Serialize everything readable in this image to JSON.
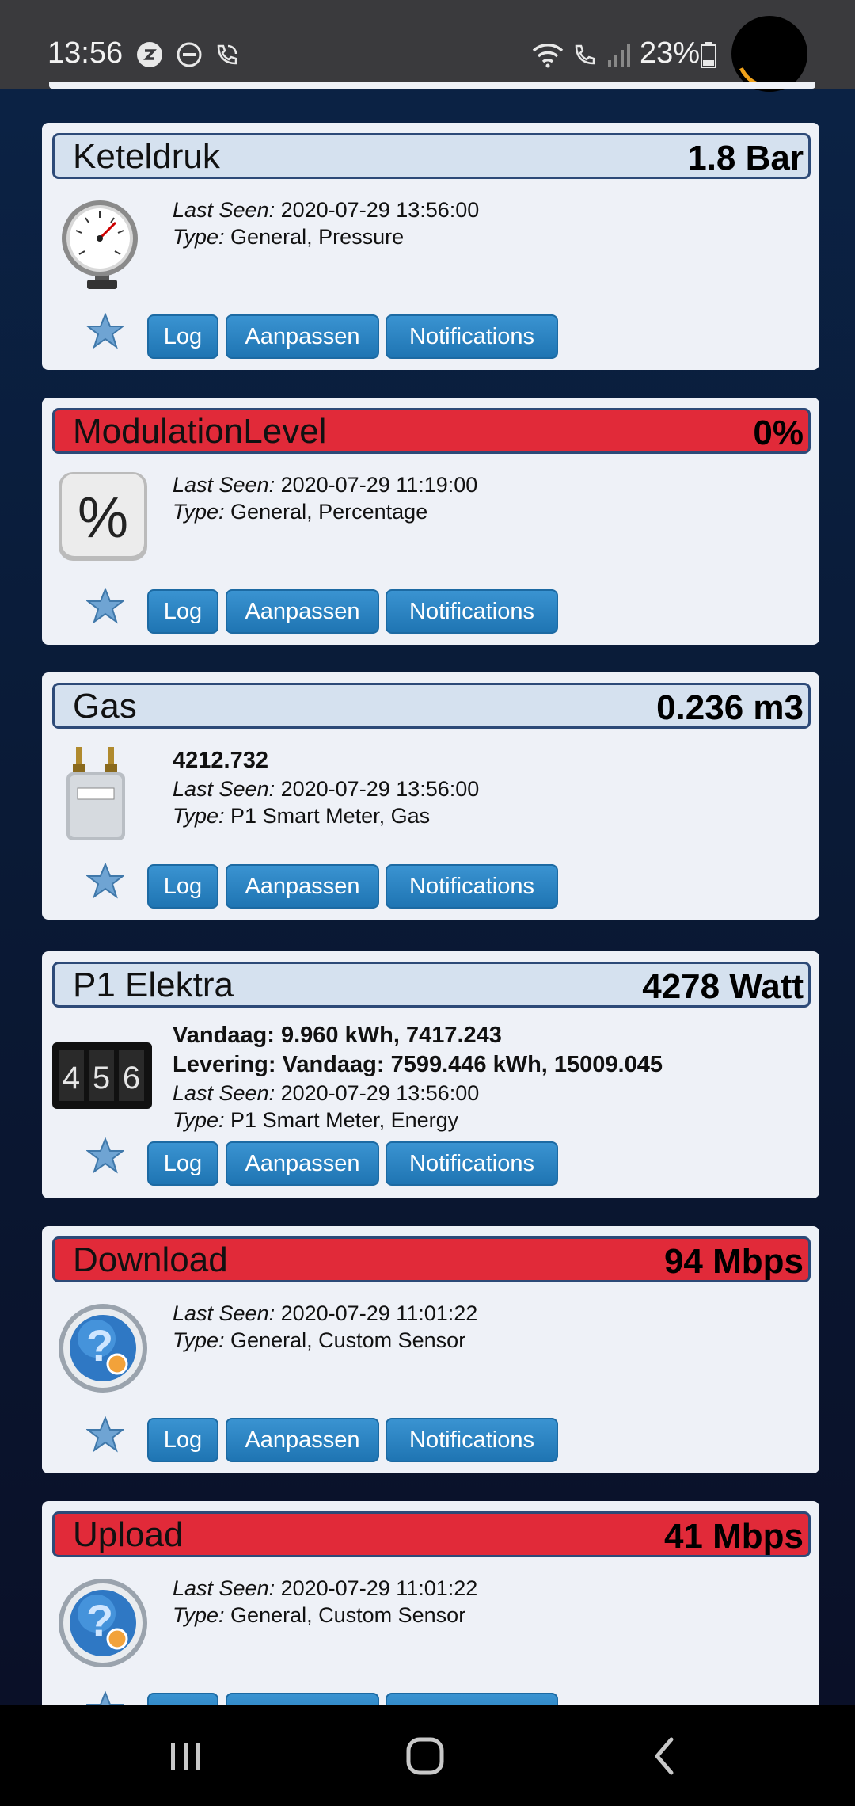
{
  "status_bar": {
    "time": "13:56",
    "battery": "23%",
    "icons": [
      "sync-icon",
      "dnd-icon",
      "wifi-call-icon",
      "wifi-icon",
      "volte-icon",
      "signal-icon",
      "battery-icon"
    ]
  },
  "colors": {
    "header_normal": "#d5e1ef",
    "header_alert": "#e12a39",
    "button": "#2581c2"
  },
  "labels": {
    "last_seen": "Last Seen:",
    "type": "Type:"
  },
  "buttons": {
    "log": "Log",
    "edit": "Aanpassen",
    "notifications": "Notifications"
  },
  "devices": [
    {
      "title": "Keteldruk",
      "value": "1.8 Bar",
      "alert": false,
      "icon": "pressure-gauge-icon",
      "extra": [],
      "last_seen": "2020-07-29 13:56:00",
      "type": "General, Pressure"
    },
    {
      "title": "ModulationLevel",
      "value": "0%",
      "alert": true,
      "icon": "percentage-icon",
      "extra": [],
      "last_seen": "2020-07-29 11:19:00",
      "type": "General, Percentage"
    },
    {
      "title": "Gas",
      "value": "0.236 m3",
      "alert": false,
      "icon": "gas-meter-icon",
      "extra": [
        "4212.732"
      ],
      "last_seen": "2020-07-29 13:56:00",
      "type": "P1 Smart Meter, Gas"
    },
    {
      "title": "P1 Elektra",
      "value": "4278 Watt",
      "alert": false,
      "icon": "energy-counter-icon",
      "extra": [
        "Vandaag: 9.960 kWh, 7417.243",
        "Levering: Vandaag: 7599.446 kWh, 15009.045"
      ],
      "last_seen": "2020-07-29 13:56:00",
      "type": "P1 Smart Meter, Energy"
    },
    {
      "title": "Download",
      "value": "94 Mbps",
      "alert": true,
      "icon": "custom-sensor-icon",
      "extra": [],
      "last_seen": "2020-07-29 11:01:22",
      "type": "General, Custom Sensor"
    },
    {
      "title": "Upload",
      "value": "41 Mbps",
      "alert": true,
      "icon": "custom-sensor-icon",
      "extra": [],
      "last_seen": "2020-07-29 11:01:22",
      "type": "General, Custom Sensor"
    }
  ],
  "nav": [
    "recent-apps-icon",
    "home-icon",
    "back-icon"
  ]
}
